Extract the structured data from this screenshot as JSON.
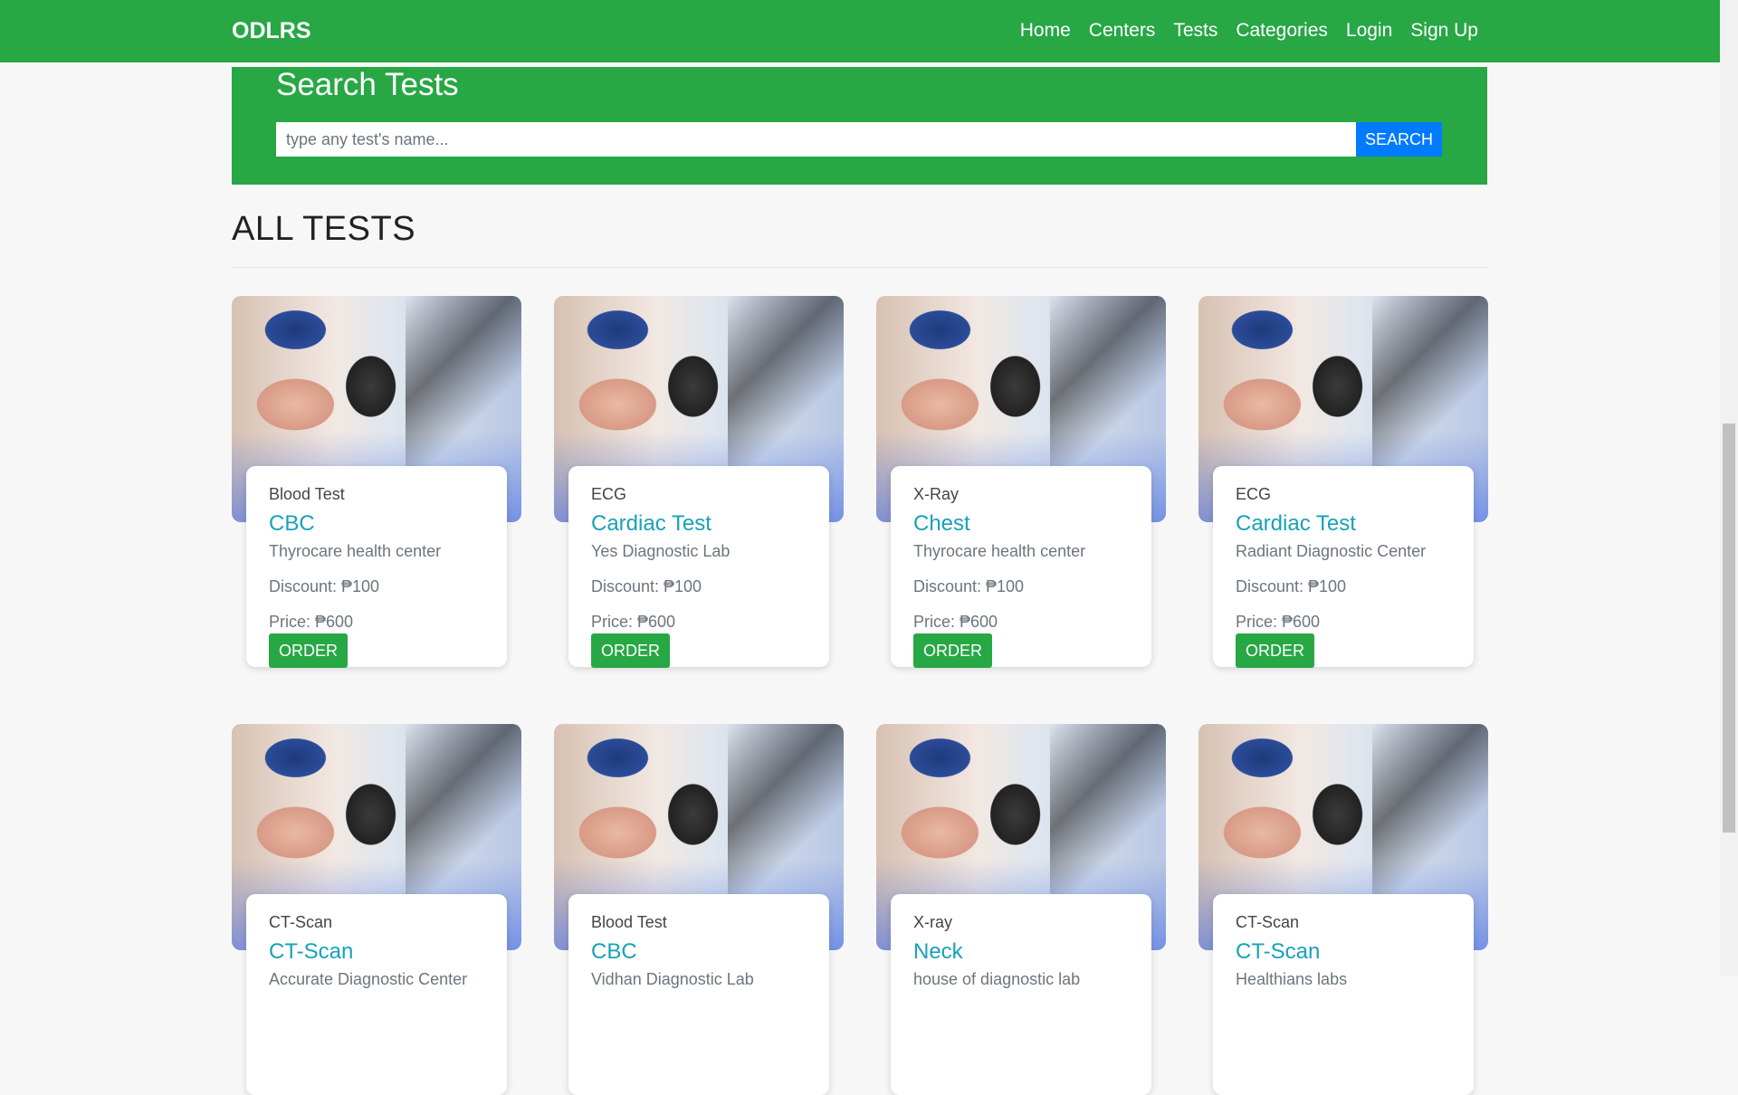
{
  "navbar": {
    "brand": "ODLRS",
    "links": [
      "Home",
      "Centers",
      "Tests",
      "Categories",
      "Login",
      "Sign Up"
    ]
  },
  "search": {
    "title": "Search Tests",
    "placeholder": "type any test's name...",
    "button": "SEARCH"
  },
  "section": {
    "heading": "ALL TESTS"
  },
  "cards": [
    {
      "category": "Blood Test",
      "title": "CBC",
      "center": "Thyrocare health center",
      "discount": "Discount: ₱100",
      "price": "Price: ₱600",
      "button": "ORDER"
    },
    {
      "category": "ECG",
      "title": "Cardiac Test",
      "center": "Yes Diagnostic Lab",
      "discount": "Discount: ₱100",
      "price": "Price: ₱600",
      "button": "ORDER"
    },
    {
      "category": "X-Ray",
      "title": "Chest",
      "center": "Thyrocare health center",
      "discount": "Discount: ₱100",
      "price": "Price: ₱600",
      "button": "ORDER"
    },
    {
      "category": "ECG",
      "title": "Cardiac Test",
      "center": "Radiant Diagnostic Center",
      "discount": "Discount: ₱100",
      "price": "Price: ₱600",
      "button": "ORDER"
    },
    {
      "category": "CT-Scan",
      "title": "CT-Scan",
      "center": "Accurate Diagnostic Center",
      "discount": "",
      "price": "",
      "button": ""
    },
    {
      "category": "Blood Test",
      "title": "CBC",
      "center": "Vidhan Diagnostic Lab",
      "discount": "",
      "price": "",
      "button": ""
    },
    {
      "category": "X-ray",
      "title": "Neck",
      "center": "house of diagnostic lab",
      "discount": "",
      "price": "",
      "button": ""
    },
    {
      "category": "CT-Scan",
      "title": "CT-Scan",
      "center": "Healthians labs",
      "discount": "",
      "price": "",
      "button": ""
    }
  ],
  "colors": {
    "primary_green": "#28a745",
    "link_teal": "#17a2b8",
    "search_blue": "#007bff"
  }
}
